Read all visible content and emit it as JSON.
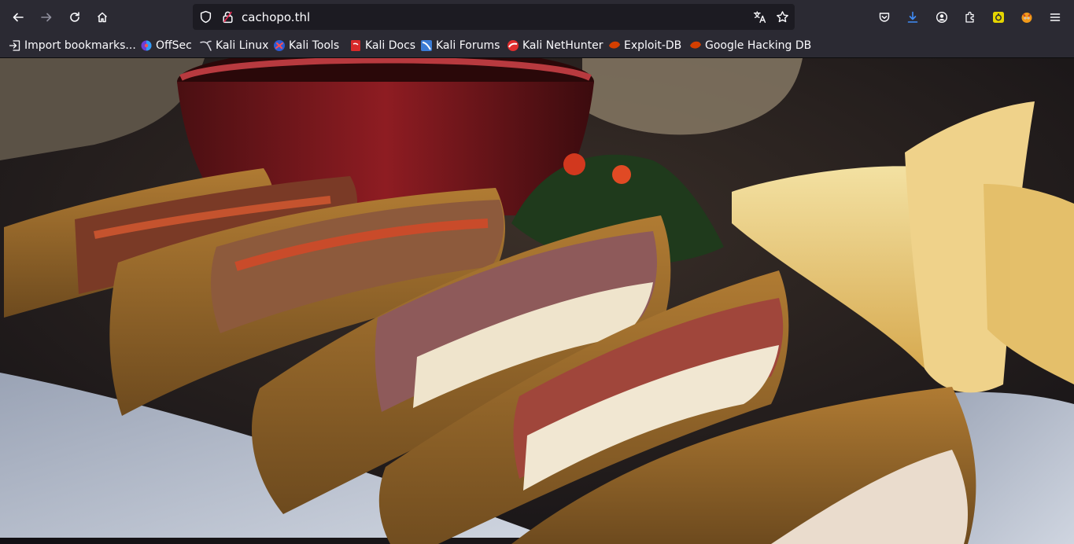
{
  "browser": {
    "url": "cachopo.thl",
    "bookmarks": [
      "Import bookmarks...",
      "OffSec",
      "Kali Linux",
      "Kali Tools",
      "Kali Docs",
      "Kali Forums",
      "Kali NetHunter",
      "Exploit-DB",
      "Google Hacking DB"
    ]
  },
  "colors": {
    "toolbar": "#2b2a33",
    "urlbar": "#1c1b22",
    "download_accent": "#3f8cf8",
    "extension_yellow": "#e5d500",
    "exploit_red": "#d43f00"
  },
  "icons": [
    "back-icon",
    "forward-icon",
    "reload-icon",
    "home-icon",
    "shield-icon",
    "lock-icon",
    "translate-icon",
    "star-icon",
    "pocket-icon",
    "download-icon",
    "account-icon",
    "extensions-icon",
    "ext-yellow-icon",
    "ext-fox-icon",
    "menu-icon"
  ],
  "page": {
    "image_subject": "cachopo"
  }
}
